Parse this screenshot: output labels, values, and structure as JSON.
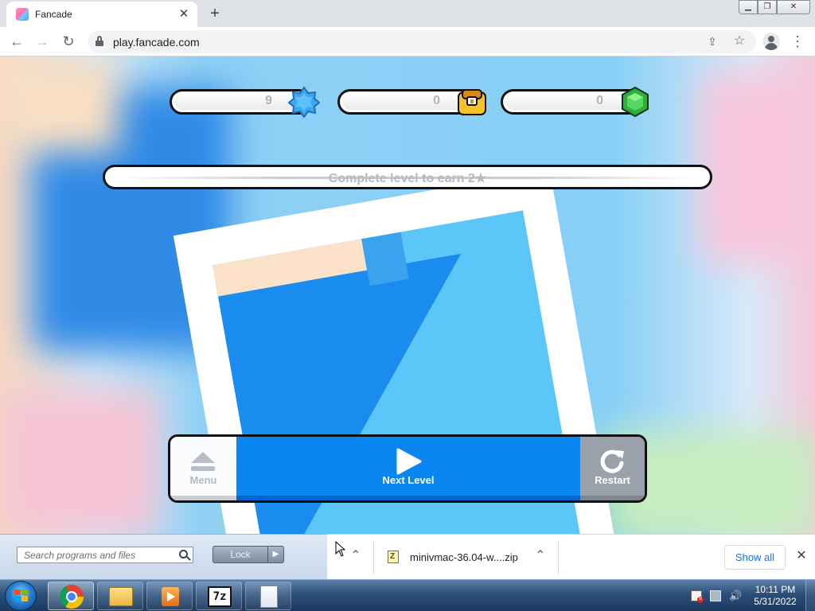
{
  "browser": {
    "tab_title": "Fancade",
    "url": "play.fancade.com",
    "new_tab_label": "+",
    "tab_close_label": "✕"
  },
  "game": {
    "counters": [
      {
        "name": "stars",
        "value": "9"
      },
      {
        "name": "chests",
        "value": "0"
      },
      {
        "name": "gems",
        "value": "0"
      }
    ],
    "progress_text": "Complete level to earn 2★",
    "buttons": {
      "menu": "Menu",
      "next": "Next Level",
      "restart": "Restart"
    },
    "colors": {
      "next_button": "#0a86f0",
      "restart_button": "#9aa1ab",
      "sky": "#86cff6"
    }
  },
  "start_menu": {
    "search_placeholder": "Search programs and files",
    "lock_label": "Lock"
  },
  "downloads": {
    "file_name": "minivmac-36.04-w....zip",
    "show_all": "Show all"
  },
  "taskbar": {
    "time": "10:11 PM",
    "date": "5/31/2022"
  }
}
